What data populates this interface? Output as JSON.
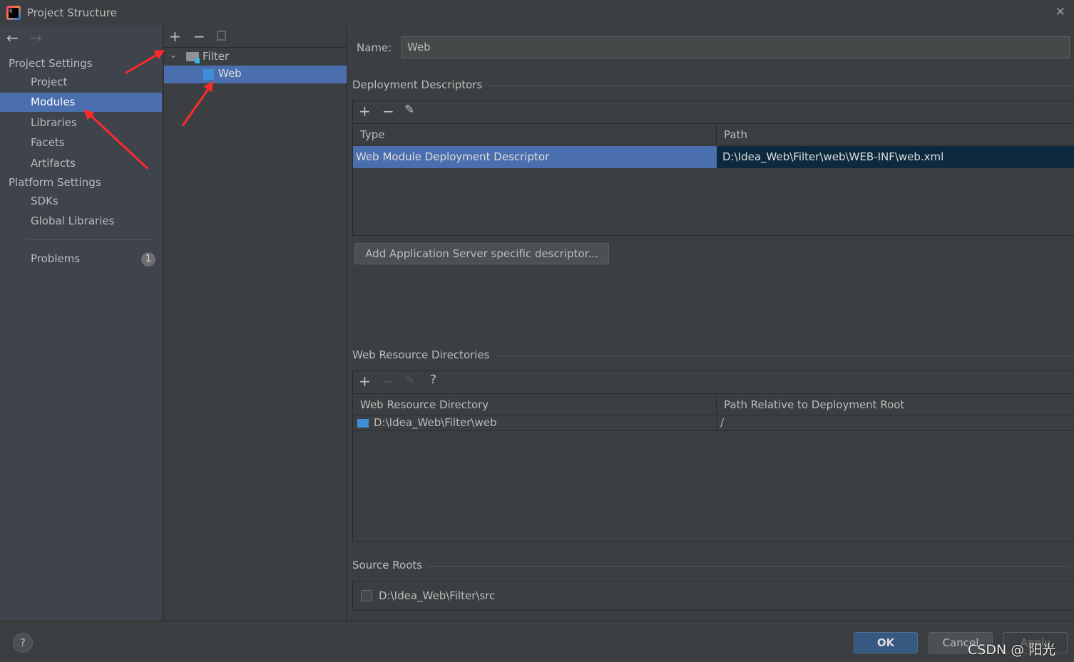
{
  "window": {
    "title": "Project Structure",
    "close": "✕",
    "logo": "IJ"
  },
  "sidebar": {
    "sections": [
      {
        "label": "Project Settings"
      },
      {
        "label": "Platform Settings"
      }
    ],
    "items": [
      {
        "label": "Project"
      },
      {
        "label": "Modules",
        "selected": true
      },
      {
        "label": "Libraries"
      },
      {
        "label": "Facets"
      },
      {
        "label": "Artifacts"
      },
      {
        "label": "SDKs"
      },
      {
        "label": "Global Libraries"
      }
    ],
    "problems": {
      "label": "Problems",
      "count": "1"
    }
  },
  "tree": {
    "root": "Filter",
    "child": "Web"
  },
  "main": {
    "name_label": "Name:",
    "name_value": "Web",
    "deployment": {
      "title": "Deployment Descriptors",
      "columns": [
        "Type",
        "Path"
      ],
      "rows": [
        {
          "type": "Web Module Deployment Descriptor",
          "path": "D:\\Idea_Web\\Filter\\web\\WEB-INF\\web.xml"
        }
      ],
      "add_button": "Add Application Server specific descriptor..."
    },
    "resources": {
      "title": "Web Resource Directories",
      "columns": [
        "Web Resource Directory",
        "Path Relative to Deployment Root"
      ],
      "rows": [
        {
          "dir": "D:\\Idea_Web\\Filter\\web",
          "rel": "/"
        }
      ],
      "help": "?"
    },
    "sources": {
      "title": "Source Roots",
      "rows": [
        {
          "path": "D:\\Idea_Web\\Filter\\src",
          "checked": false
        }
      ]
    }
  },
  "footer": {
    "help": "?",
    "ok": "OK",
    "cancel": "Cancel",
    "apply": "Apply"
  },
  "watermark": "CSDN @ 阳光",
  "colors": {
    "selection": "#4b6eaf",
    "annotation_arrow": "#ff2a2a",
    "ok_button": "#365880"
  }
}
